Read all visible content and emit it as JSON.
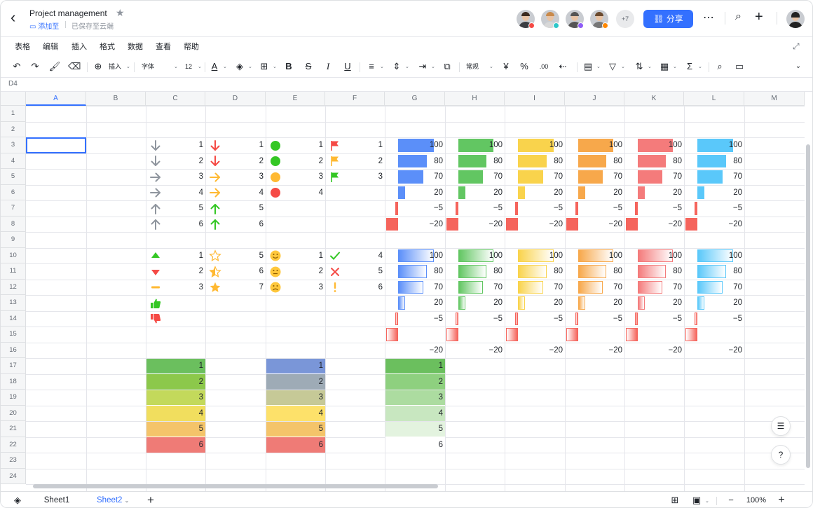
{
  "doc": {
    "title": "Project management",
    "add_to": "添加至",
    "saved": "已保存至云端"
  },
  "header": {
    "more_count": "+7",
    "share_label": "分享"
  },
  "menu": [
    "表格",
    "编辑",
    "插入",
    "格式",
    "数据",
    "查看",
    "帮助"
  ],
  "toolbar": {
    "insert_label": "插入",
    "font_label": "字体",
    "font_size": "12",
    "format_label": "常规",
    "currency": "¥",
    "percent": "%"
  },
  "cell_ref": "D4",
  "columns": [
    "A",
    "B",
    "C",
    "D",
    "E",
    "F",
    "G",
    "H",
    "I",
    "J",
    "K",
    "L",
    "M"
  ],
  "rows": [
    "1",
    "2",
    "3",
    "4",
    "5",
    "6",
    "7",
    "8",
    "9",
    "10",
    "11",
    "12",
    "13",
    "14",
    "15",
    "16",
    "17",
    "18",
    "19",
    "20",
    "21",
    "22",
    "23",
    "24"
  ],
  "icon_sets": {
    "arrows_gray": [
      {
        "icon": "arrow-down",
        "v": "1"
      },
      {
        "icon": "arrow-down",
        "v": "2"
      },
      {
        "icon": "arrow-right",
        "v": "3"
      },
      {
        "icon": "arrow-right",
        "v": "4"
      },
      {
        "icon": "arrow-up",
        "v": "5"
      },
      {
        "icon": "arrow-up",
        "v": "6"
      }
    ],
    "arrows_color": [
      {
        "icon": "arrow-down",
        "v": "1"
      },
      {
        "icon": "arrow-down",
        "v": "2"
      },
      {
        "icon": "arrow-right",
        "v": "3"
      },
      {
        "icon": "arrow-right",
        "v": "4"
      },
      {
        "icon": "arrow-up",
        "v": "5"
      },
      {
        "icon": "arrow-up",
        "v": "6"
      }
    ],
    "circles": [
      {
        "icon": "green-circle",
        "v": "1"
      },
      {
        "icon": "green-circle",
        "v": "2"
      },
      {
        "icon": "yellow-circle",
        "v": "3"
      },
      {
        "icon": "red-circle",
        "v": "4"
      }
    ],
    "flags": [
      {
        "icon": "red-flag",
        "v": "1"
      },
      {
        "icon": "yellow-flag",
        "v": "2"
      },
      {
        "icon": "green-flag",
        "v": "3"
      }
    ],
    "triangles": [
      {
        "icon": "triangle-up",
        "v": "1"
      },
      {
        "icon": "triangle-down",
        "v": "2"
      },
      {
        "icon": "dash",
        "v": "3"
      },
      {
        "icon": "thumbs-up",
        "v": ""
      },
      {
        "icon": "thumbs-down",
        "v": ""
      }
    ],
    "stars": [
      {
        "icon": "star-empty",
        "v": "5"
      },
      {
        "icon": "star-half",
        "v": "6"
      },
      {
        "icon": "star-full",
        "v": "7"
      }
    ],
    "faces": [
      {
        "icon": "smile-face",
        "v": "1"
      },
      {
        "icon": "neutral-face",
        "v": "2"
      },
      {
        "icon": "sad-face",
        "v": "3"
      }
    ],
    "marks": [
      {
        "icon": "check-mark",
        "v": "4"
      },
      {
        "icon": "cross-mark",
        "v": "5"
      },
      {
        "icon": "exclamation-mark",
        "v": "6"
      }
    ]
  },
  "databars": {
    "values": [
      "100",
      "80",
      "70",
      "20",
      "−5",
      "−20"
    ],
    "numbers": [
      100,
      80,
      70,
      20,
      -5,
      -20
    ],
    "colors": [
      "#5b8ff9",
      "#62c662",
      "#f9d34c",
      "#f7a84b",
      "#f47b7b",
      "#5ac8fa"
    ]
  },
  "color_scales": {
    "c": {
      "values": [
        "1",
        "2",
        "3",
        "4",
        "5",
        "6"
      ],
      "colors": [
        "#6bbf5e",
        "#8cc84b",
        "#c3d95b",
        "#f1de5e",
        "#f4c46a",
        "#ef7b76"
      ]
    },
    "e": {
      "values": [
        "1",
        "2",
        "3",
        "4",
        "5",
        "6"
      ],
      "colors": [
        "#7a96d8",
        "#9eabb6",
        "#c6c997",
        "#fde16a",
        "#f4c46a",
        "#ef7b76"
      ]
    },
    "g": {
      "values": [
        "1",
        "2",
        "3",
        "4",
        "5",
        "6"
      ],
      "colors": [
        "#6bbf5e",
        "#8ed07f",
        "#acdca0",
        "#c8e7c0",
        "#e3f3df",
        "#ffffff"
      ]
    }
  },
  "sheets": [
    "Sheet1",
    "Sheet2"
  ],
  "active_sheet": "Sheet2",
  "zoom": "100%",
  "icon_colors": {
    "gray": "#8f959e",
    "red": "#f54a45",
    "orange": "#ffb932",
    "green": "#34c724",
    "blue": "#3370ff"
  }
}
